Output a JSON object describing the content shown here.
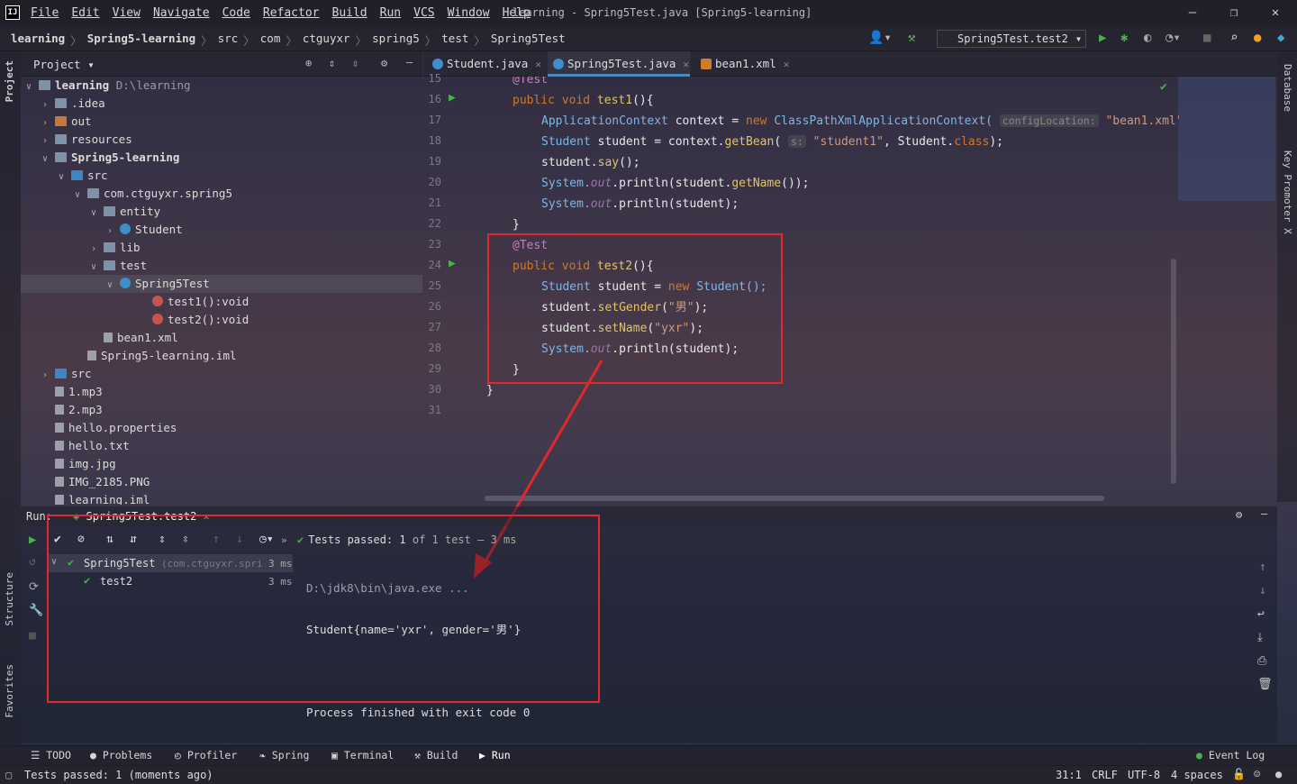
{
  "menubar": {
    "items": [
      "File",
      "Edit",
      "View",
      "Navigate",
      "Code",
      "Refactor",
      "Build",
      "Run",
      "VCS",
      "Window",
      "Help"
    ],
    "title": "learning - Spring5Test.java [Spring5-learning]"
  },
  "breadcrumbs": [
    "learning",
    "Spring5-learning",
    "src",
    "com",
    "ctguyxr",
    "spring5",
    "test",
    "Spring5Test"
  ],
  "run_config": "Spring5Test.test2",
  "left_strip": {
    "project": "Project",
    "structure": "Structure",
    "favorites": "Favorites"
  },
  "right_strip": {
    "database": "Database",
    "key_promoter": "Key Promoter X"
  },
  "project_panel": {
    "title": "Project",
    "tree": [
      {
        "label": "learning",
        "extra": "D:\\learning",
        "depth": 0,
        "fold": "open",
        "icon": "folder",
        "bold": true
      },
      {
        "label": ".idea",
        "depth": 1,
        "fold": "closed",
        "icon": "folder"
      },
      {
        "label": "out",
        "depth": 1,
        "fold": "closed",
        "icon": "orange"
      },
      {
        "label": "resources",
        "depth": 1,
        "fold": "closed",
        "icon": "folder"
      },
      {
        "label": "Spring5-learning",
        "depth": 1,
        "fold": "open",
        "icon": "folder",
        "bold": true
      },
      {
        "label": "src",
        "depth": 2,
        "fold": "open",
        "icon": "blue"
      },
      {
        "label": "com.ctguyxr.spring5",
        "depth": 3,
        "fold": "open",
        "icon": "folder"
      },
      {
        "label": "entity",
        "depth": 4,
        "fold": "open",
        "icon": "folder"
      },
      {
        "label": "Student",
        "depth": 5,
        "fold": "closed",
        "icon": "cls"
      },
      {
        "label": "lib",
        "depth": 4,
        "fold": "closed",
        "icon": "folder"
      },
      {
        "label": "test",
        "depth": 4,
        "fold": "open",
        "icon": "folder"
      },
      {
        "label": "Spring5Test",
        "depth": 5,
        "fold": "open",
        "icon": "cls",
        "selected": true
      },
      {
        "label": "test1():void",
        "depth": 7,
        "icon": "m"
      },
      {
        "label": "test2():void",
        "depth": 7,
        "icon": "m"
      },
      {
        "label": "bean1.xml",
        "depth": 4,
        "icon": "file"
      },
      {
        "label": "Spring5-learning.iml",
        "depth": 3,
        "icon": "file"
      },
      {
        "label": "src",
        "depth": 1,
        "fold": "closed",
        "icon": "blue"
      },
      {
        "label": "1.mp3",
        "depth": 1,
        "icon": "file"
      },
      {
        "label": "2.mp3",
        "depth": 1,
        "icon": "file"
      },
      {
        "label": "hello.properties",
        "depth": 1,
        "icon": "file"
      },
      {
        "label": "hello.txt",
        "depth": 1,
        "icon": "file"
      },
      {
        "label": "img.jpg",
        "depth": 1,
        "icon": "file"
      },
      {
        "label": "IMG_2185.PNG",
        "depth": 1,
        "icon": "file"
      },
      {
        "label": "learning.iml",
        "depth": 1,
        "icon": "file"
      }
    ]
  },
  "editor_tabs": [
    {
      "label": "Student.java",
      "active": false
    },
    {
      "label": "Spring5Test.java",
      "active": true
    },
    {
      "label": "bean1.xml",
      "active": false
    }
  ],
  "line_numbers": [
    "15",
    "16",
    "17",
    "18",
    "19",
    "20",
    "21",
    "22",
    "23",
    "24",
    "25",
    "26",
    "27",
    "28",
    "29",
    "30",
    "31"
  ],
  "code": {
    "l15": "@Test",
    "l16a": "public void ",
    "l16b": "test1",
    "l16c": "(){",
    "l17a": "ApplicationContext ",
    "l17b": "context = ",
    "l17c": "new ",
    "l17d": "ClassPathXmlApplicationContext(",
    "l17e": "configLocation:",
    "l17f": "\"bean1.xml\"",
    "l18a": "Student ",
    "l18b": "student = context.",
    "l18c": "getBean",
    "l18d": "( ",
    "l18e": "s:",
    "l18f": "\"student1\"",
    ", ": "",
    "l18g": ", Student.",
    "l18h": "class",
    "l18i": ");",
    "l19a": "student.",
    "l19b": "say",
    "l19c": "();",
    "l20a": "System.",
    "l20b": "out",
    "l20c": ".println(student.",
    "l20d": "getName",
    "l20e": "());",
    "l21a": "System.",
    "l21b": "out",
    "l21c": ".println(student);",
    "l22": "}",
    "l23": "@Test",
    "l24a": "public void ",
    "l24b": "test2",
    "l24c": "(){",
    "l25a": "Student ",
    "l25b": "student = ",
    "l25c": "new ",
    "l25d": "Student();",
    "l26a": "student.",
    "l26b": "setGender",
    "l26c": "(",
    "l26d": "\"男\"",
    "l26e": ");",
    "l27a": "student.",
    "l27b": "setName",
    "l27c": "(",
    "l27d": "\"yxr\"",
    "l27e": ");",
    "l28a": "System.",
    "l28b": "out",
    "l28c": ".println(student);",
    "l29": "}",
    "l30": "}"
  },
  "run_panel": {
    "label": "Run:",
    "tab": "Spring5Test.test2",
    "tests_passed": "Tests passed:",
    "count": "1",
    "of": "of 1 test",
    "time_suffix": "– 3 ms",
    "tree": [
      {
        "name": "Spring5Test",
        "pkg": "(com.ctguyxr.spri",
        "time": "3 ms"
      },
      {
        "name": "test2",
        "time": "3 ms"
      }
    ],
    "console": [
      "D:\\jdk8\\bin\\java.exe ...",
      "Student{name='yxr', gender='男'}",
      "",
      "Process finished with exit code 0"
    ]
  },
  "bottom_tabs": [
    "TODO",
    "Problems",
    "Profiler",
    "Spring",
    "Terminal",
    "Build",
    "Run",
    "Event Log"
  ],
  "status": {
    "message": "Tests passed: 1 (moments ago)",
    "position": "31:1",
    "line_sep": "CRLF",
    "encoding": "UTF-8",
    "indent": "4 spaces"
  },
  "colors": {
    "annotation_red": "#e0282e",
    "accent_blue": "#4a88c7",
    "pass_green": "#4caf50"
  }
}
